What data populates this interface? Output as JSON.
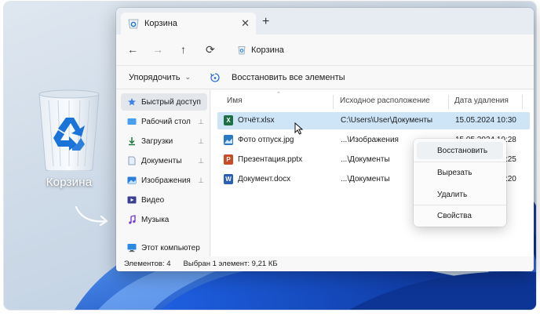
{
  "window": {
    "tab_title": "Корзина",
    "tab_close": "✕",
    "new_tab": "+",
    "address_text": "Корзина"
  },
  "nav": {
    "back": "←",
    "forward": "→",
    "up": "↑",
    "refresh": "⟳"
  },
  "command_bar": {
    "sort_label": "Упорядочить",
    "sort_chevron": "⌄",
    "restore_all_label": "Восстановить все элементы"
  },
  "sidebar": {
    "items": [
      {
        "label": "Быстрый доступ",
        "icon": "star-icon",
        "pinned": false
      },
      {
        "label": "Рабочий стол",
        "icon": "desktop-folder-icon",
        "pinned": true
      },
      {
        "label": "Загрузки",
        "icon": "downloads-folder-icon",
        "pinned": true
      },
      {
        "label": "Документы",
        "icon": "documents-folder-icon",
        "pinned": true
      },
      {
        "label": "Изображения",
        "icon": "pictures-folder-icon",
        "pinned": true
      },
      {
        "label": "Видео",
        "icon": "video-folder-icon",
        "pinned": false
      },
      {
        "label": "Музыка",
        "icon": "music-folder-icon",
        "pinned": false
      },
      {
        "label": "Этот компьютер",
        "icon": "computer-icon",
        "pinned": false
      }
    ],
    "pin_glyph": "📌"
  },
  "columns": {
    "name": "Имя",
    "original_location": "Исходное расположение",
    "date_deleted": "Дата удаления"
  },
  "files": [
    {
      "name": "Отчёт.xlsx",
      "location": "C:\\Users\\User\\Документы",
      "date": "15.05.2024 10:30",
      "badge": "X",
      "color": "#1d7044",
      "selected": true
    },
    {
      "name": "Фото отпуск.jpg",
      "location": "...\\Изображения",
      "date": "15.05.2024 10:28",
      "badge": "",
      "color": "#2a78c8",
      "selected": false
    },
    {
      "name": "Презентация.pptx",
      "location": "...\\Документы",
      "date": "15.05.2024 10:25",
      "badge": "P",
      "color": "#c84b25",
      "selected": false
    },
    {
      "name": "Документ.docx",
      "location": "...\\Документы",
      "date": "15.05.2024 10:20",
      "badge": "W",
      "color": "#2b5fb4",
      "selected": false
    }
  ],
  "status": {
    "count": "Элементов: 4",
    "selection": "Выбран 1 элемент: 9,21 КБ"
  },
  "context_menu": {
    "items": [
      "Восстановить",
      "Вырезать",
      "Удалить",
      "Свойства"
    ]
  },
  "desktop": {
    "recycle_bin_label": "Корзина"
  },
  "colors": {
    "accent": "#0067c0",
    "selection": "#cde5f7",
    "titlebar": "#e7ecf2"
  }
}
